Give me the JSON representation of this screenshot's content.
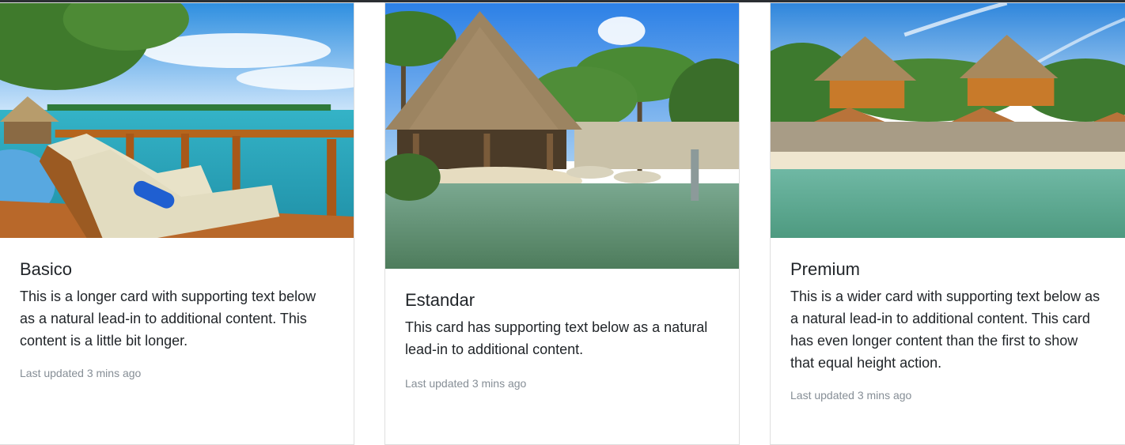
{
  "cards": [
    {
      "title": "Basico",
      "text": "This is a longer card with supporting text below as a natural lead-in to additional content. This content is a little bit longer.",
      "updated": "Last updated 3 mins ago",
      "image": "ocean-deck-loungers-photo"
    },
    {
      "title": "Estandar",
      "text": "This card has supporting text below as a natural lead-in to additional content.",
      "updated": "Last updated 3 mins ago",
      "image": "palapa-pool-palms-photo"
    },
    {
      "title": "Premium",
      "text": "This is a wider card with supporting text below as a natural lead-in to additional content. This card has even longer content than the first to show that equal height action.",
      "updated": "Last updated 3 mins ago",
      "image": "beach-bungalows-photo"
    }
  ]
}
